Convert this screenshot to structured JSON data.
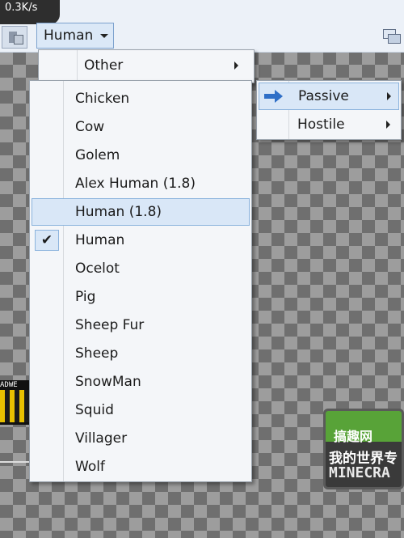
{
  "toolbar": {
    "speed": "0.3K/s",
    "model_dropdown": "Human"
  },
  "menu_top": {
    "other_label": "Other"
  },
  "submenu": {
    "items": [
      {
        "label": "Passive"
      },
      {
        "label": "Hostile"
      }
    ]
  },
  "model_menu": {
    "items": [
      {
        "label": "Chicken"
      },
      {
        "label": "Cow"
      },
      {
        "label": "Golem"
      },
      {
        "label": "Alex Human (1.8)"
      },
      {
        "label": "Human (1.8)"
      },
      {
        "label": "Human"
      },
      {
        "label": "Ocelot"
      },
      {
        "label": "Pig"
      },
      {
        "label": "Sheep Fur"
      },
      {
        "label": "Sheep"
      },
      {
        "label": "SnowMan"
      },
      {
        "label": "Squid"
      },
      {
        "label": "Villager"
      },
      {
        "label": "Wolf"
      }
    ],
    "check_glyph": "✔"
  },
  "background_art": {
    "strip_text": "ADWE",
    "logo_line1": "搞趣网",
    "logo_line2": "我的世界专",
    "logo_line3": "MINECRA"
  },
  "colors": {
    "highlight": "#d9e7f7",
    "highlight_border": "#8bb3dd",
    "arrow_blue": "#2f6fc7"
  }
}
